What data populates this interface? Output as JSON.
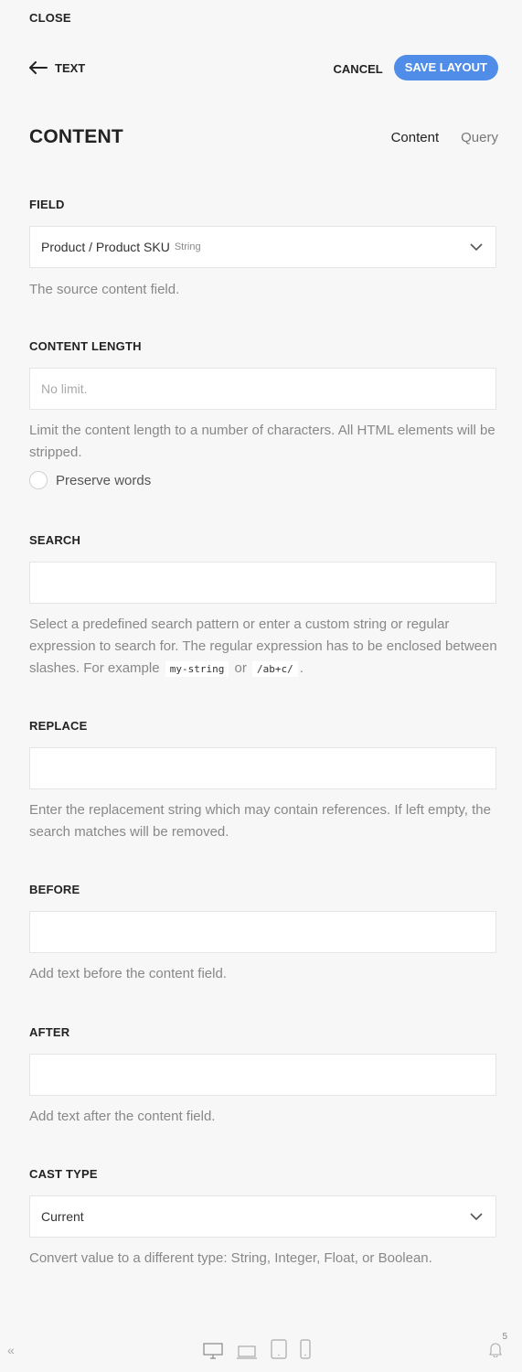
{
  "header": {
    "close_label": "CLOSE",
    "back_label": "TEXT",
    "cancel_label": "CANCEL",
    "save_label": "SAVE LAYOUT",
    "accent_color": "#4f8de8"
  },
  "section": {
    "title": "CONTENT",
    "tabs": [
      {
        "label": "Content",
        "active": true
      },
      {
        "label": "Query",
        "active": false
      }
    ]
  },
  "fields": {
    "field": {
      "label": "FIELD",
      "value": "Product / Product SKU",
      "type_hint": "String",
      "help": "The source content field."
    },
    "content_length": {
      "label": "CONTENT LENGTH",
      "placeholder": "No limit.",
      "help": "Limit the content length to a number of characters. All HTML elements will be stripped.",
      "checkbox_label": "Preserve words"
    },
    "search": {
      "label": "SEARCH",
      "value": "",
      "help_before": "Select a predefined search pattern or enter a custom string or regular expression to search for. The regular expression has to be enclosed between slashes. For example",
      "code1": "my-string",
      "or": "or",
      "code2": "/ab+c/",
      "help_after": "."
    },
    "replace": {
      "label": "REPLACE",
      "value": "",
      "help": "Enter the replacement string which may contain references. If left empty, the search matches will be removed."
    },
    "before": {
      "label": "BEFORE",
      "value": "",
      "help": "Add text before the content field."
    },
    "after": {
      "label": "AFTER",
      "value": "",
      "help": "Add text after the content field."
    },
    "cast_type": {
      "label": "CAST TYPE",
      "value": "Current",
      "help": "Convert value to a different type: String, Integer, Float, or Boolean."
    }
  },
  "footer": {
    "collapse_glyph": "«",
    "devices": [
      "desktop-icon",
      "laptop-icon",
      "tablet-icon",
      "phone-icon"
    ],
    "notification_count": "5"
  }
}
